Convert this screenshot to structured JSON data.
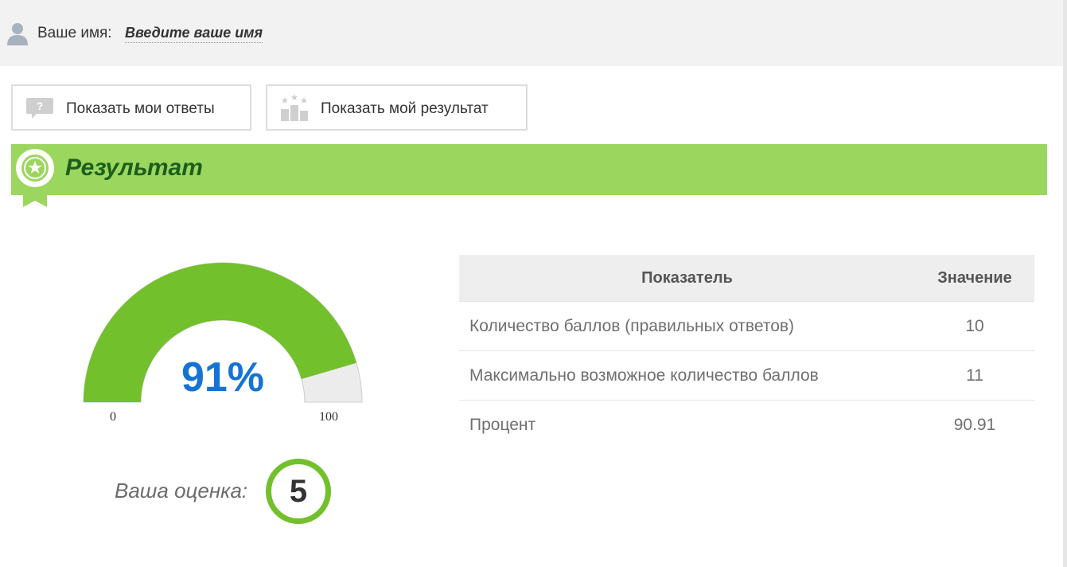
{
  "header": {
    "name_label": "Ваше имя:",
    "name_placeholder": "Введите ваше имя"
  },
  "buttons": {
    "show_answers": "Показать мои ответы",
    "show_result": "Показать мой результат"
  },
  "result": {
    "title": "Результат",
    "gauge": {
      "value_text": "91%",
      "percent": 90.91,
      "min": "0",
      "max": "100"
    },
    "grade_label": "Ваша оценка:",
    "grade": "5"
  },
  "stats_table": {
    "headers": [
      "Показатель",
      "Значение"
    ],
    "rows": [
      [
        "Количество баллов (правильных ответов)",
        "10"
      ],
      [
        "Максимально возможное количество баллов",
        "11"
      ],
      [
        "Процент",
        "90.91"
      ]
    ]
  },
  "colors": {
    "header_bar": "#9bd75e",
    "header_title": "#1d5e1d",
    "gauge_fill": "#72c02c",
    "gauge_empty": "#ececec",
    "gauge_value": "#1573d4",
    "grade_ring": "#72c02c"
  },
  "icons": {
    "user": "user-icon",
    "answers_button": "question-bubble-icon",
    "result_button": "podium-stars-icon",
    "result_header": "award-badge-icon"
  }
}
